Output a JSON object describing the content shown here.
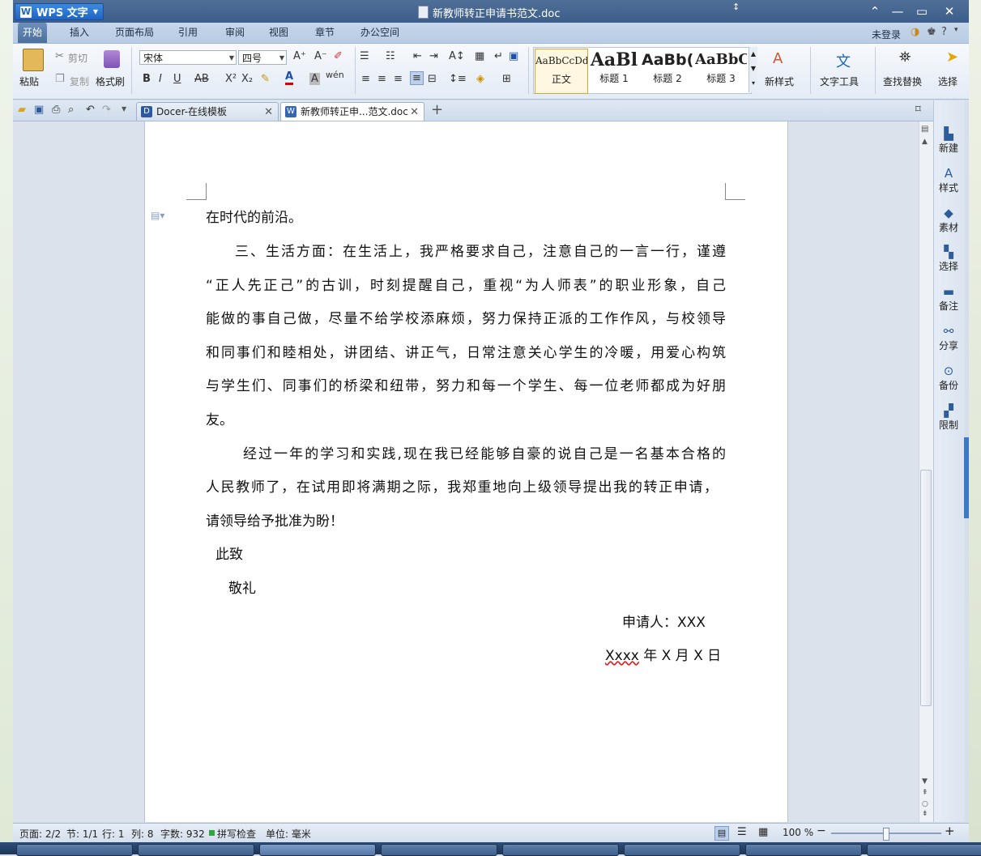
{
  "app": {
    "name": "WPS 文字",
    "doc_title": "新教师转正申请书范文.doc"
  },
  "menu": [
    "开始",
    "插入",
    "页面布局",
    "引用",
    "审阅",
    "视图",
    "章节",
    "办公空间"
  ],
  "account": {
    "login": "未登录"
  },
  "ribbon": {
    "paste": "粘贴",
    "cut": "剪切",
    "copy": "复制",
    "format_painter": "格式刷",
    "font_name": "宋体",
    "font_size": "四号",
    "styles": [
      {
        "sample": "AaBbCcDd",
        "name": "正文"
      },
      {
        "sample": "AaBl",
        "name": "标题 1"
      },
      {
        "sample": "AaBb(",
        "name": "标题 2"
      },
      {
        "sample": "AaBbC",
        "name": "标题 3"
      }
    ],
    "new_style": "新样式",
    "text_tools": "文字工具",
    "find_replace": "查找替换",
    "select": "选择"
  },
  "tabs": [
    {
      "label": "Docer-在线模板"
    },
    {
      "label": "新教师转正申...范文.doc"
    }
  ],
  "document": {
    "p1": "在时代的前沿。",
    "p2_lines": [
      "三、生活方面：在生活上，我严格要求自己，注意自己的一言一行，谨遵",
      "“正人先正己”的古训，时刻提醒自己，重视“为人师表”的职业形象，自己",
      "能做的事自己做，尽量不给学校添麻烦，努力保持正派的工作作风，与校领导",
      "和同事们和睦相处，讲团结、讲正气，日常注意关心学生的冷暖，用爱心构筑",
      "与学生们、同事们的桥梁和纽带，努力和每一个学生、每一位老师都成为好朋",
      "友。"
    ],
    "p3_lines": [
      "经过一年的学习和实践,现在我已经能够自豪的说自己是一名基本合格的",
      "人民教师了，在试用即将满期之际，我郑重地向上级领导提出我的转正申请，",
      "请领导给予批准为盼！"
    ],
    "closing1": "此致",
    "closing2": "敬礼",
    "applicant": "申请人：XXX",
    "date_prefix": "Xxxx",
    "date_rest": " 年 X 月 X 日"
  },
  "taskpane": [
    "新建",
    "样式",
    "素材",
    "选择",
    "备注",
    "分享",
    "备份",
    "限制"
  ],
  "status": {
    "page": "页面: 2/2",
    "section": "节: 1/1",
    "line": "行: 1",
    "col": "列: 8",
    "words": "字数: 932",
    "spell": "拼写检查",
    "unit": "单位: 毫米",
    "zoom": "100 %"
  },
  "zoom_level": 0.5
}
